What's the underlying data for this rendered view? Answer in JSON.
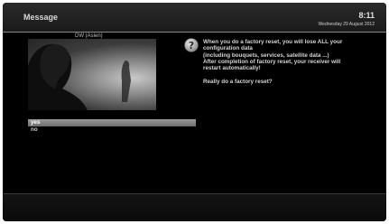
{
  "header": {
    "title": "Message",
    "time": "8:11",
    "date": "Wednesday 29 August 2012"
  },
  "preview": {
    "channel_name": "DW (Asien)"
  },
  "dialog": {
    "icon": "question-icon",
    "message": "When you do a factory reset, you will lose ALL your\nconfiguration data\n(including bouquets, services, satellite data ...)\nAfter completion of factory reset, your receiver will\nrestart automatically!\n\nReally do a factory reset?",
    "options": [
      {
        "label": "yes",
        "selected": true
      },
      {
        "label": "no",
        "selected": false
      }
    ]
  }
}
